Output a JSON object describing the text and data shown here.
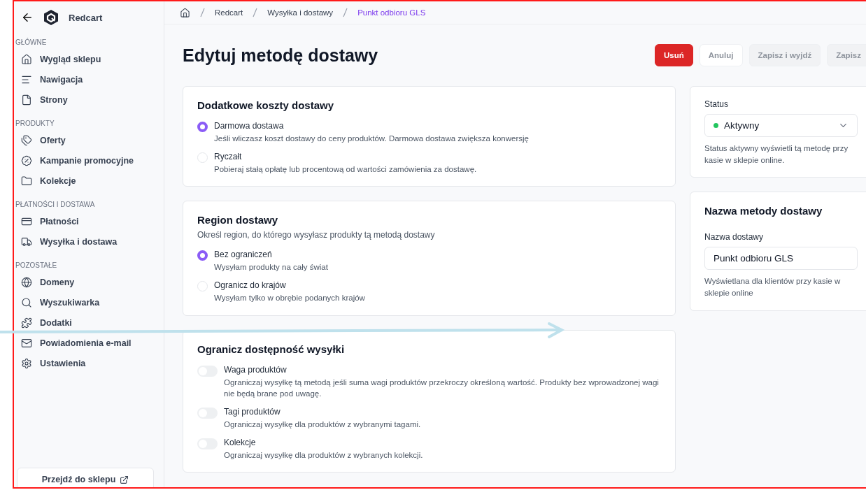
{
  "sidebar": {
    "brand": "Redcart",
    "sections": [
      {
        "title": "GŁÓWNE",
        "items": [
          {
            "label": "Wygląd sklepu"
          },
          {
            "label": "Nawigacja"
          },
          {
            "label": "Strony"
          }
        ]
      },
      {
        "title": "PRODUKTY",
        "items": [
          {
            "label": "Oferty"
          },
          {
            "label": "Kampanie promocyjne"
          },
          {
            "label": "Kolekcje"
          }
        ]
      },
      {
        "title": "PŁATNOŚCI I DOSTAWA",
        "items": [
          {
            "label": "Płatności"
          },
          {
            "label": "Wysyłka i dostawa"
          }
        ]
      },
      {
        "title": "POZOSTAŁE",
        "items": [
          {
            "label": "Domeny"
          },
          {
            "label": "Wyszukiwarka"
          },
          {
            "label": "Dodatki"
          },
          {
            "label": "Powiadomienia e-mail"
          },
          {
            "label": "Ustawienia"
          }
        ]
      }
    ],
    "store_link": "Przejdź do sklepu"
  },
  "breadcrumb": [
    {
      "label": "Redcart",
      "current": false
    },
    {
      "label": "Wysyłka i dostawy",
      "current": false
    },
    {
      "label": "Punkt odbioru GLS",
      "current": true
    }
  ],
  "title": "Edytuj metodę dostawy",
  "actions": [
    {
      "label": "Usuń",
      "kind": "danger",
      "disabled": false
    },
    {
      "label": "Anuluj",
      "kind": "outline",
      "disabled": true
    },
    {
      "label": "Zapisz i wyjdź",
      "kind": "filled",
      "disabled": true
    },
    {
      "label": "Zapisz",
      "kind": "filled",
      "disabled": true
    }
  ],
  "cards": [
    {
      "kind": "radio",
      "title": "Dodatkowe koszty dostawy",
      "options": [
        {
          "label": "Darmowa dostawa",
          "description": "Jeśli wliczasz koszt dostawy do ceny produktów. Darmowa dostawa zwiększa konwersję",
          "selected": true
        },
        {
          "label": "Ryczałt",
          "description": "Pobieraj stałą opłatę lub procentową od wartości zamówienia za dostawę.",
          "selected": false
        }
      ]
    },
    {
      "kind": "radio",
      "title": "Region dostawy",
      "description": "Określ region, do którego wysyłasz produkty tą metodą dostawy",
      "options": [
        {
          "label": "Bez ograniczeń",
          "description": "Wysyłam produkty na cały świat",
          "selected": true
        },
        {
          "label": "Ogranicz do krajów",
          "description": "Wysyłam tylko w obrębie podanych krajów",
          "selected": false
        }
      ]
    },
    {
      "kind": "toggle",
      "title": "Ogranicz dostępność wysyłki",
      "options": [
        {
          "label": "Waga produktów",
          "description": "Ograniczaj wysyłkę tą metodą jeśli suma wagi produktów przekroczy określoną wartość. Produkty bez wprowadzonej wagi nie będą brane pod uwagę.",
          "on": false
        },
        {
          "label": "Tagi produktów",
          "description": "Ograniczaj wysyłkę dla produktów z wybranymi tagami.",
          "on": false
        },
        {
          "label": "Kolekcje",
          "description": "Ograniczaj wysyłkę dla produktów z wybranych kolekcji.",
          "on": false
        }
      ]
    }
  ],
  "status": {
    "label": "Status",
    "value": "Aktywny",
    "color": "#22c55e",
    "help": "Status aktywny wyświetli tą metodę przy kasie w sklepie online."
  },
  "name_card": {
    "title": "Nazwa metody dostawy",
    "label": "Nazwa dostawy",
    "value": "Punkt odbioru GLS",
    "help": "Wyświetlana dla klientów przy kasie w sklepie online"
  }
}
